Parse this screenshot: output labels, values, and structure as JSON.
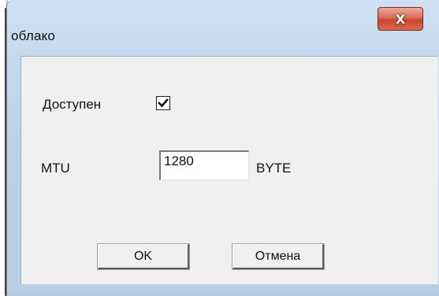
{
  "window": {
    "title": "облако",
    "close_glyph": "X"
  },
  "form": {
    "enabled_label": "Доступен",
    "enabled_checked": true,
    "mtu_label": "MTU",
    "mtu_value": "1280",
    "mtu_unit": "BYTE"
  },
  "buttons": {
    "ok_label": "OK",
    "cancel_label": "Отмена"
  },
  "icons": {
    "close": "close-icon",
    "checkmark": "checkmark-icon"
  },
  "colors": {
    "close_button": "#c9452b",
    "frame": "#bed3ea",
    "client_bg": "#f0f0f0"
  }
}
